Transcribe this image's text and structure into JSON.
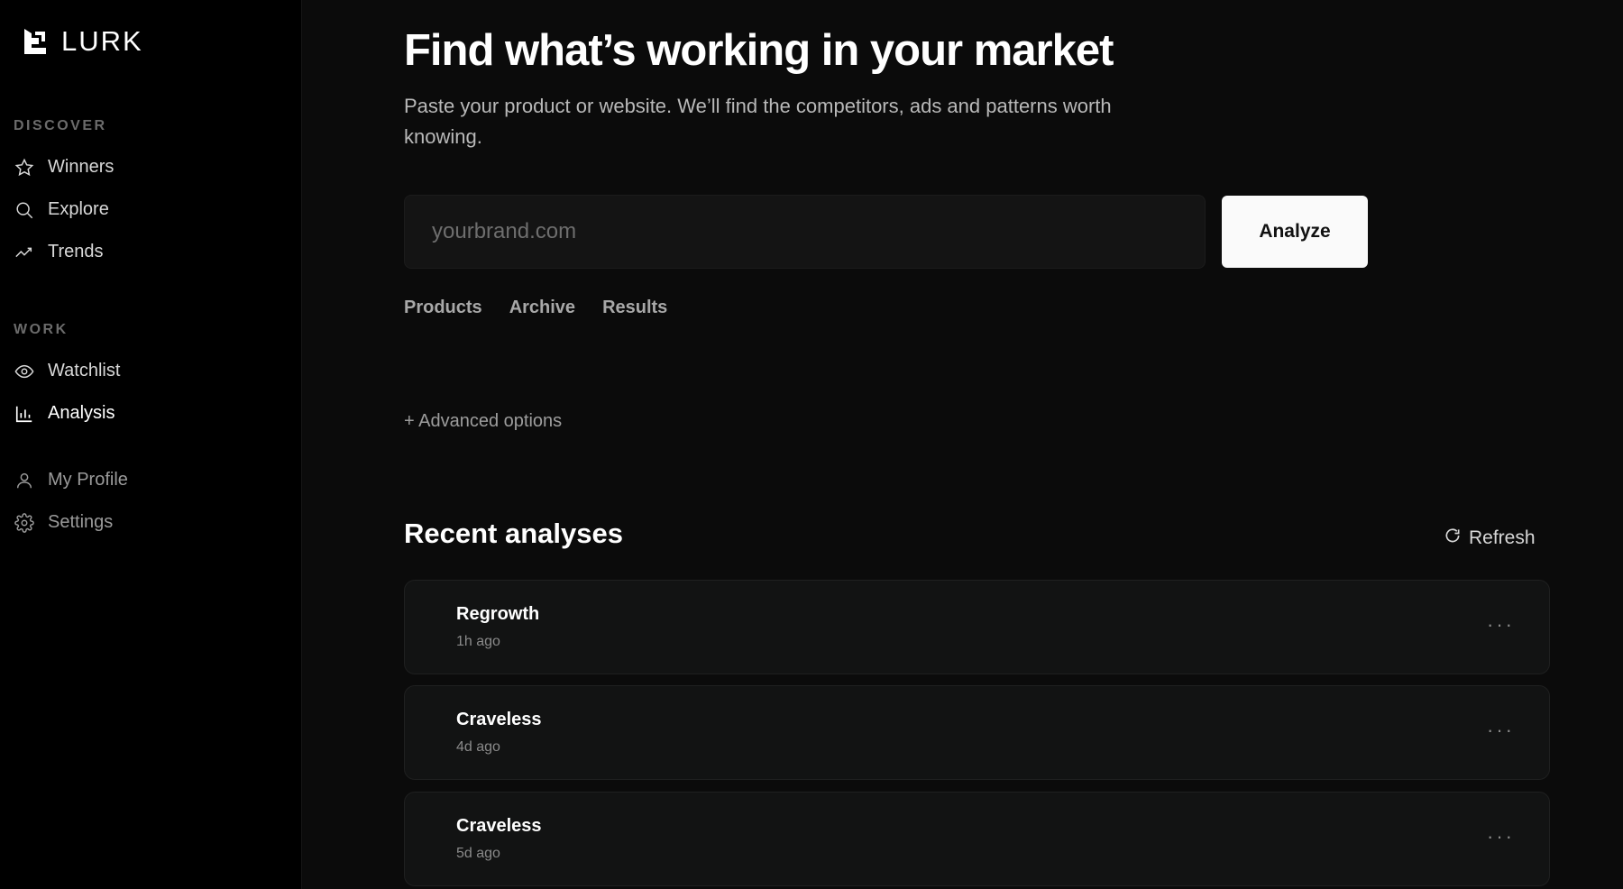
{
  "brand": {
    "name": "LURK"
  },
  "sidebar": {
    "sections": [
      {
        "label": "DISCOVER"
      },
      {
        "label": "WORK"
      }
    ],
    "items": [
      {
        "label": "Winners",
        "icon": "star-icon"
      },
      {
        "label": "Explore",
        "icon": "search-icon"
      },
      {
        "label": "Trends",
        "icon": "trend-icon"
      },
      {
        "label": "Watchlist",
        "icon": "eye-icon"
      },
      {
        "label": "Analysis",
        "icon": "bar-chart-icon",
        "active": true
      },
      {
        "label": "My Profile",
        "icon": "user-icon"
      },
      {
        "label": "Settings",
        "icon": "gear-icon"
      }
    ]
  },
  "main": {
    "title": "Find what’s working in your market",
    "subtitle": "Paste your product or website. We’ll find the competitors, ads and patterns worth knowing.",
    "search": {
      "placeholder": "yourbrand.com",
      "value": ""
    },
    "analyze_label": "Analyze",
    "tabs": [
      {
        "label": "Products"
      },
      {
        "label": "Archive"
      },
      {
        "label": "Results"
      }
    ],
    "advanced_label": "+ Advanced options",
    "recent": {
      "title": "Recent analyses",
      "refresh_label": "Refresh",
      "items": [
        {
          "name": "Regrowth",
          "time": "1h ago"
        },
        {
          "name": "Craveless",
          "time": "4d ago"
        },
        {
          "name": "Craveless",
          "time": "5d ago"
        }
      ],
      "menu_label": "···"
    }
  },
  "colors": {
    "background": "#0b0b0b",
    "sidebar": "#000000",
    "card": "#121313",
    "button": "#fafafa"
  }
}
